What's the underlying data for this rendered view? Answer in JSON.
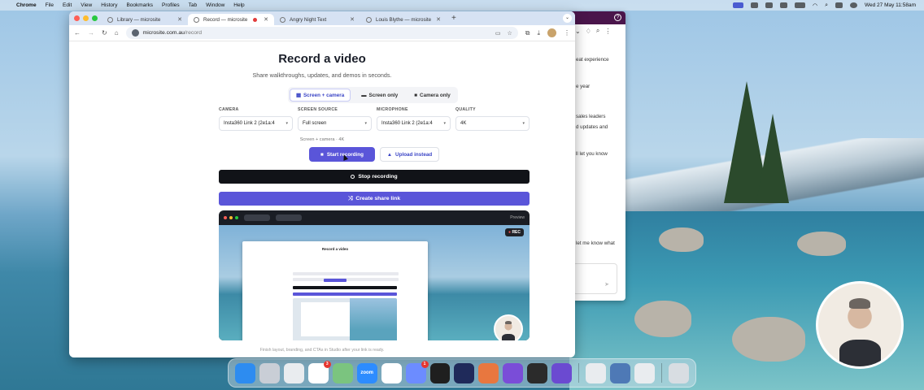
{
  "menubar": {
    "app": "Chrome",
    "items": [
      "File",
      "Edit",
      "View",
      "History",
      "Bookmarks",
      "Profiles",
      "Tab",
      "Window",
      "Help"
    ],
    "datetime": "Wed 27 May  11:58am"
  },
  "browser": {
    "tabs": [
      {
        "label": "Library — microsite"
      },
      {
        "label": "Record — microsite",
        "recording": true
      },
      {
        "label": "Angry Night Text"
      },
      {
        "label": "Louis Blythe — microsite"
      }
    ],
    "url_host": "microsite.com.au",
    "url_path": "/record"
  },
  "page": {
    "title": "Record a video",
    "subtitle": "Share walkthroughs, updates, and demos in seconds.",
    "modes": [
      {
        "label": "Screen + camera",
        "icon": "grid-icon",
        "active": true
      },
      {
        "label": "Screen only",
        "icon": "monitor-icon",
        "active": false
      },
      {
        "label": "Camera only",
        "icon": "video-icon",
        "active": false
      }
    ],
    "fields": {
      "camera": {
        "label": "CAMERA",
        "value": "Insta360 Link 2 (2e1a:4"
      },
      "screen": {
        "label": "SCREEN SOURCE",
        "value": "Full screen"
      },
      "mic": {
        "label": "MICROPHONE",
        "value": "Insta360 Link 2 (2e1a:4"
      },
      "quality": {
        "label": "QUALITY",
        "value": "4K"
      }
    },
    "summary": "Screen + camera · 4K",
    "start_label": "Start recording",
    "upload_label": "Upload instead",
    "stop_label": "Stop recording",
    "share_label": "Create share link",
    "preview": {
      "label": "Preview",
      "rec_badge": "REC",
      "inner_title": "Record a video"
    },
    "footer": "Finish layout, branding, and CTAs in Studio after your link is ready."
  },
  "backwindow": {
    "lines": [
      "eat experience",
      "e year",
      "sales leaders",
      "d updates and",
      "ll let you know",
      "let me know what"
    ]
  },
  "dock": {
    "apps": [
      {
        "name": "finder-icon",
        "color": "#2d8cf0"
      },
      {
        "name": "launchpad-icon",
        "color": "#c9ced6"
      },
      {
        "name": "chrome-icon",
        "color": "#e9ecef"
      },
      {
        "name": "slack-icon",
        "color": "#ffffff",
        "badge": "3"
      },
      {
        "name": "maps-icon",
        "color": "#7bc47f"
      },
      {
        "name": "zoom-icon",
        "color": "#2d8cff",
        "text": "zoom"
      },
      {
        "name": "chatgpt-icon",
        "color": "#ffffff"
      },
      {
        "name": "messenger-icon",
        "color": "#6c8cff",
        "badge": "1"
      },
      {
        "name": "cursor-icon",
        "color": "#1f1f1f"
      },
      {
        "name": "terminal-icon",
        "color": "#1f2a5a"
      },
      {
        "name": "claude-icon",
        "color": "#e8773f"
      },
      {
        "name": "github-icon",
        "color": "#7a4dd8"
      },
      {
        "name": "globe-icon",
        "color": "#2b2b2b"
      },
      {
        "name": "obsidian-icon",
        "color": "#6b4ad1"
      },
      {
        "name": "chrome-icon-2",
        "color": "#e9ecef"
      },
      {
        "name": "preview-icon",
        "color": "#4e79b6"
      },
      {
        "name": "chrome-icon-3",
        "color": "#e9ecef"
      },
      {
        "name": "trash-icon",
        "color": "#d8dde2"
      }
    ]
  }
}
